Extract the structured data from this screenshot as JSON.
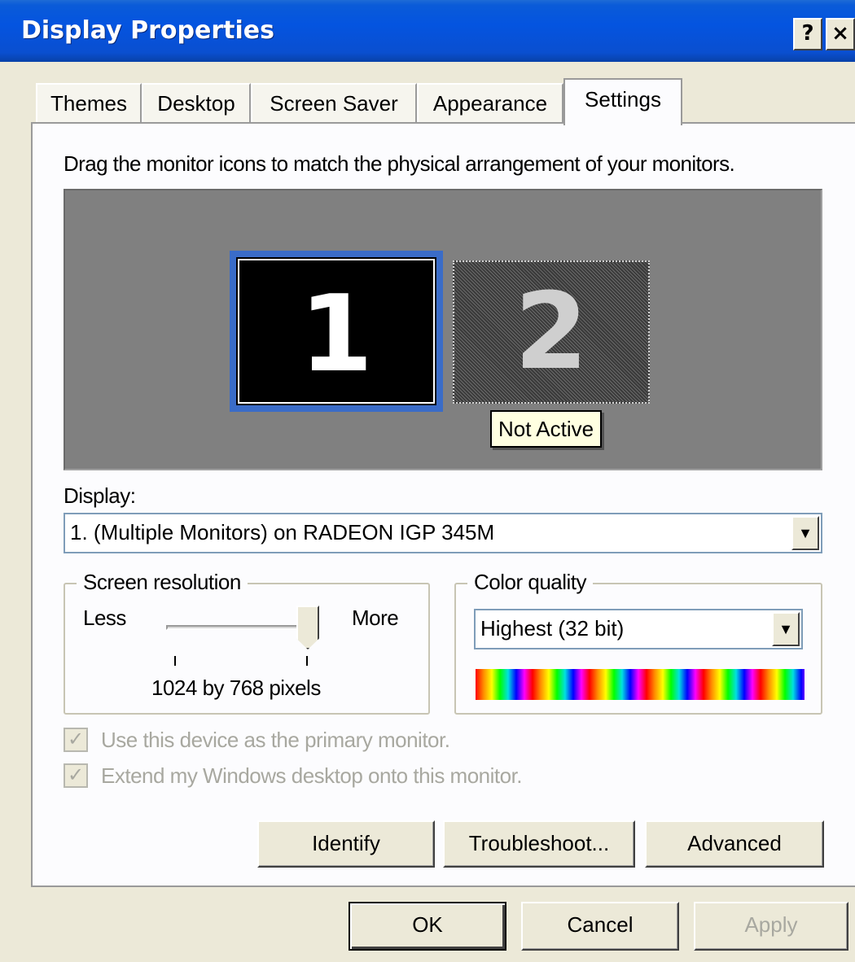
{
  "window": {
    "title": "Display Properties",
    "help_label": "?",
    "close_label": "×"
  },
  "tabs": [
    {
      "label": "Themes"
    },
    {
      "label": "Desktop"
    },
    {
      "label": "Screen Saver"
    },
    {
      "label": "Appearance"
    },
    {
      "label": "Settings",
      "active": true
    }
  ],
  "settings": {
    "instruction": "Drag the monitor icons to match the physical arrangement of your monitors.",
    "monitors": [
      {
        "number": "1",
        "state": "selected"
      },
      {
        "number": "2",
        "state": "inactive"
      }
    ],
    "tooltip": "Not Active",
    "display_label": "Display:",
    "display_value": "1. (Multiple Monitors) on RADEON IGP 345M",
    "screen_resolution": {
      "legend": "Screen resolution",
      "less_label": "Less",
      "more_label": "More",
      "value_text": "1024 by 768 pixels",
      "slider_level": 1.0
    },
    "color_quality": {
      "legend": "Color quality",
      "value": "Highest (32 bit)"
    },
    "checkboxes": [
      {
        "label": "Use this device as the primary monitor.",
        "checked": true,
        "enabled": false
      },
      {
        "label": "Extend my Windows desktop onto this monitor.",
        "checked": true,
        "enabled": false
      }
    ],
    "buttons": {
      "identify": "Identify",
      "troubleshoot": "Troubleshoot...",
      "advanced": "Advanced"
    }
  },
  "footer": {
    "ok": "OK",
    "cancel": "Cancel",
    "apply": "Apply"
  },
  "colors": {
    "title_bar": "#0454e0",
    "selection_border": "#3a6cc8",
    "dialog_bg": "#ece9d8",
    "monitor_area": "#808080"
  }
}
